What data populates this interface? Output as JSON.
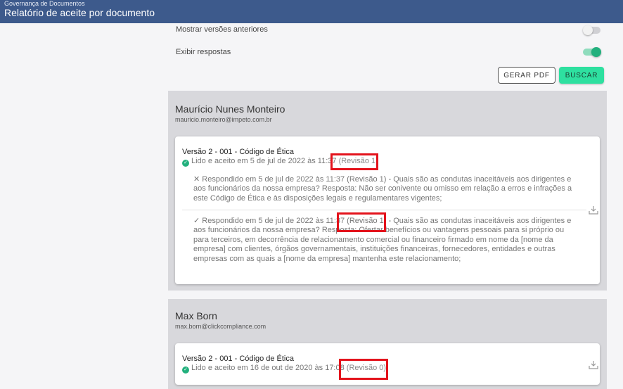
{
  "header": {
    "subtitle": "Governança de Documentos",
    "title": "Relatório de aceite por documento"
  },
  "filters": {
    "show_previous_versions": {
      "label": "Mostrar versões anteriores",
      "on": false
    },
    "show_answers": {
      "label": "Exibir respostas",
      "on": true
    }
  },
  "actions": {
    "pdf_label": "GERAR PDF",
    "search_label": "BUSCAR"
  },
  "colors": {
    "header_bg": "#3d5a8c",
    "accent_green": "#22b07d",
    "button_green": "#2ee0a0",
    "highlight_red": "#e3131c"
  },
  "users": [
    {
      "name": "Maurício Nunes Monteiro",
      "email": "mauricio.monteiro@impeto.com.br",
      "document": {
        "title": "Versão 2 - 001 - Código de Ética",
        "status_icon": "check-circle-icon",
        "status": "Lido e aceito em 5 de jul de 2022 às 11:37",
        "revision": "(Revisão 1)",
        "answers": [
          {
            "icon": "x-icon",
            "text": "Respondido em 5 de jul de 2022 às 11:37 (Revisão 1) - Quais são as condutas inaceitáveis aos dirigentes e aos funcionários da nossa empresa? Resposta: Não ser conivente ou omisso em relação a erros e infrações a este Código de Ética e às disposições legais e regulamentares vigentes;"
          },
          {
            "icon": "checkmark-icon",
            "text": "Respondido em 5 de jul de 2022 às 11:37 (Revisão 1) - Quais são as condutas inaceitáveis aos dirigentes e aos funcionários da nossa empresa? Resposta: Ofertar benefícios ou vantagens pessoais para si próprio ou para terceiros, em decorrência de relacionamento comercial ou financeiro firmado em nome da [nome da empresa] com clientes, órgãos governamentais, instituições financeiras, fornecedores, entidades e outras empresas com as quais a [nome da empresa] mantenha este relacionamento;"
          }
        ]
      }
    },
    {
      "name": "Max Born",
      "email": "max.born@clickcompliance.com",
      "document": {
        "title": "Versão 2 - 001 - Código de Ética",
        "status_icon": "check-circle-icon",
        "status": "Lido e aceito em 16 de out de 2020 às 17:08",
        "revision": "(Revisão 0)"
      }
    }
  ]
}
